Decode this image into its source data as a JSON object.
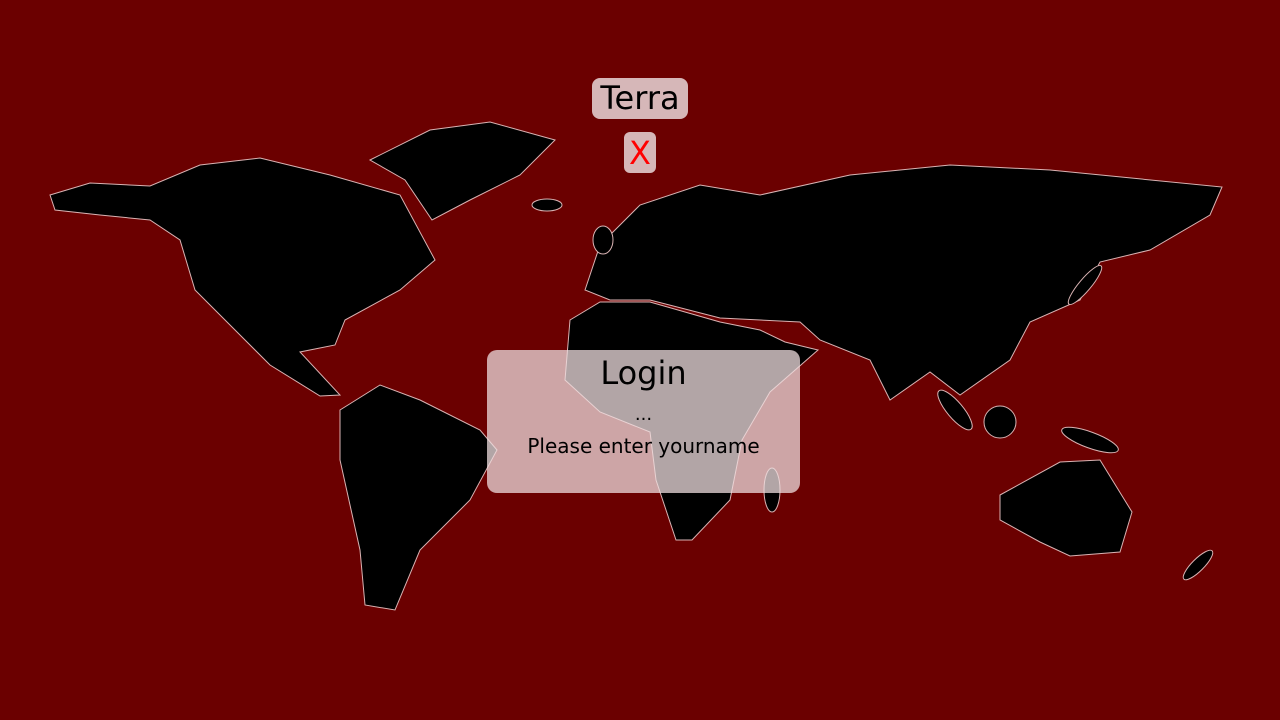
{
  "app": {
    "title": "Terra",
    "close_label": "X"
  },
  "login": {
    "title": "Login",
    "status": "...",
    "message": "Please enter yourname"
  },
  "colors": {
    "background": "#6b0000",
    "land": "#000000",
    "panel": "#d6b7b8",
    "close": "#ff0000"
  }
}
